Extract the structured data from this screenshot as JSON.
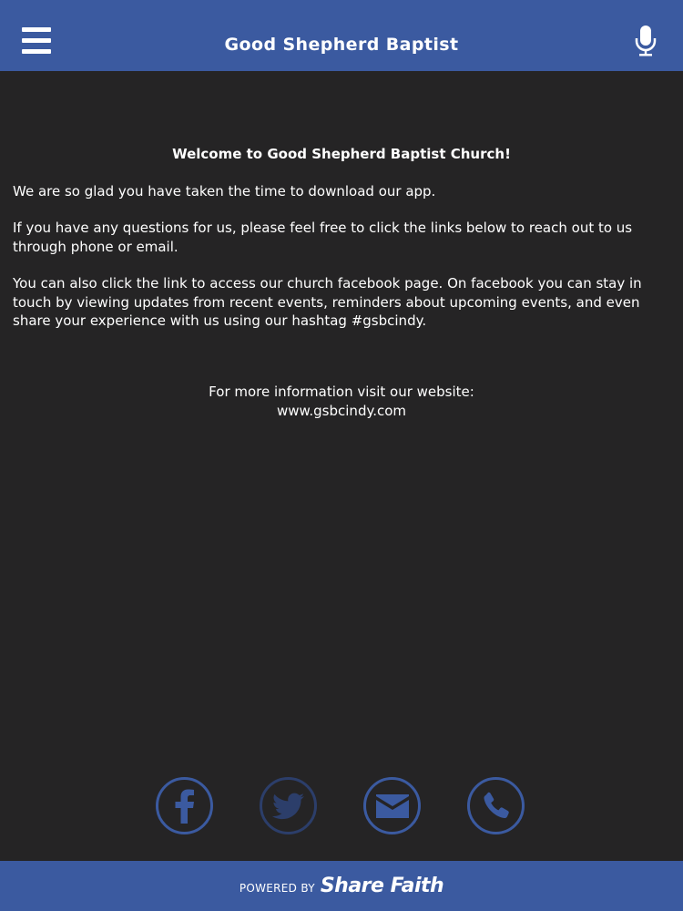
{
  "header": {
    "title": "Good Shepherd Baptist",
    "menu_icon": "hamburger-menu-icon",
    "mic_icon": "microphone-icon"
  },
  "content": {
    "heading": "Welcome to Good Shepherd Baptist Church!",
    "paragraphs": [
      "We are so glad you have taken the time to download our app.",
      "If you have any questions for us, please feel free to click the links below to reach out to us through phone or email.",
      "You can also click the link to access our church facebook page. On facebook you can stay in touch by viewing updates from recent events, reminders about upcoming events, and even share your experience with us using our hashtag #gsbcindy."
    ],
    "info_label": "For more information visit our website:",
    "website": "www.gsbcindy.com"
  },
  "social": [
    {
      "icon": "facebook-icon"
    },
    {
      "icon": "twitter-icon"
    },
    {
      "icon": "email-icon"
    },
    {
      "icon": "phone-icon"
    }
  ],
  "footer": {
    "powered_by": "POWERED BY",
    "brand": "Share Faith"
  },
  "colors": {
    "header_bg": "#3b5aa0",
    "body_bg": "#252425",
    "text": "#ffffff",
    "accent": "#3b5aa0"
  }
}
